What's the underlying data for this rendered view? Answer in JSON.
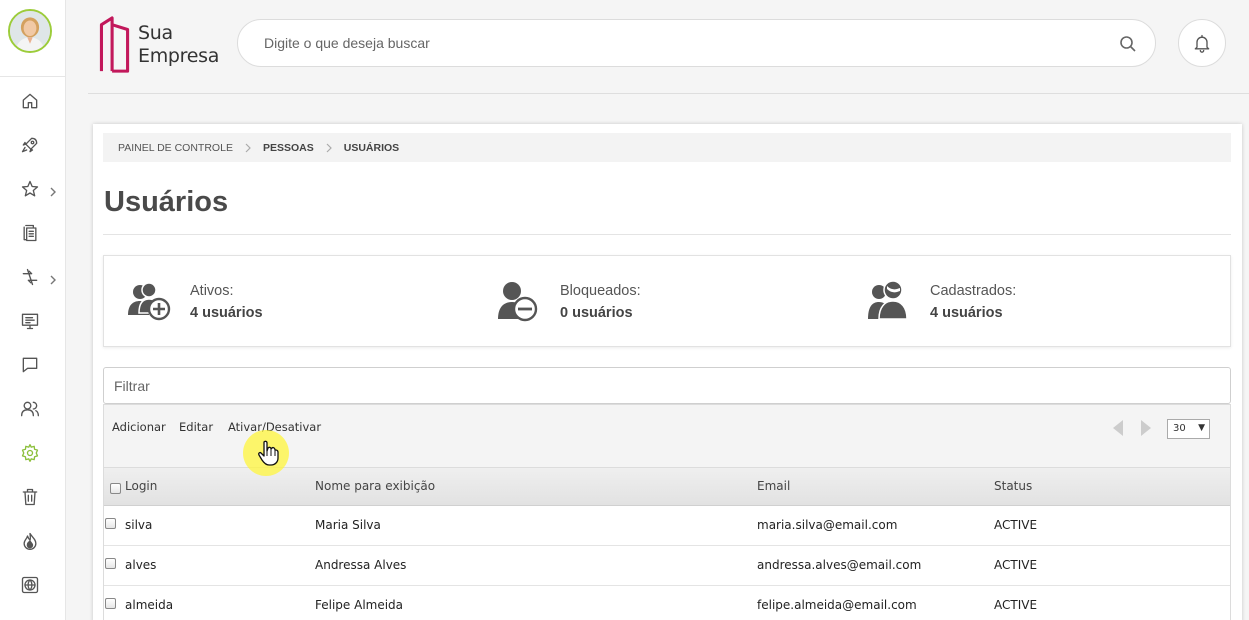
{
  "brand": {
    "line1": "Sua",
    "line2": "Empresa",
    "color": "#c2185b"
  },
  "search": {
    "placeholder": "Digite o que deseja buscar"
  },
  "sidebar": {
    "accent": "#8bbf3a",
    "items": [
      {
        "icon": "home-icon"
      },
      {
        "icon": "rocket-icon"
      },
      {
        "icon": "star-icon",
        "has_submenu": true
      },
      {
        "icon": "documents-icon"
      },
      {
        "icon": "arrows-icon",
        "has_submenu": true
      },
      {
        "icon": "monitor-icon"
      },
      {
        "icon": "chat-icon"
      },
      {
        "icon": "users-icon"
      },
      {
        "icon": "settings-icon",
        "active": true
      },
      {
        "icon": "trash-icon"
      },
      {
        "icon": "flame-icon"
      },
      {
        "icon": "globe-icon"
      }
    ]
  },
  "breadcrumb": [
    "PAINEL DE CONTROLE",
    "PESSOAS",
    "USUÁRIOS"
  ],
  "page_title": "Usuários",
  "stats": [
    {
      "label": "Ativos:",
      "value": "4 usuários",
      "icon": "users-add-icon"
    },
    {
      "label": "Bloqueados:",
      "value": "0 usuários",
      "icon": "user-blocked-icon"
    },
    {
      "label": "Cadastrados:",
      "value": "4 usuários",
      "icon": "users-registered-icon"
    }
  ],
  "filter": {
    "placeholder": "Filtrar"
  },
  "toolbar": {
    "add": "Adicionar",
    "edit": "Editar",
    "toggle": "Ativar/Desativar",
    "page_size": "30"
  },
  "table": {
    "columns": [
      "Login",
      "Nome para exibição",
      "Email",
      "Status"
    ],
    "rows": [
      {
        "login": "silva",
        "name": "Maria Silva",
        "email": "maria.silva@email.com",
        "status": "ACTIVE"
      },
      {
        "login": "alves",
        "name": "Andressa Alves",
        "email": "andressa.alves@email.com",
        "status": "ACTIVE"
      },
      {
        "login": "almeida",
        "name": "Felipe Almeida",
        "email": "felipe.almeida@email.com",
        "status": "ACTIVE"
      }
    ]
  }
}
